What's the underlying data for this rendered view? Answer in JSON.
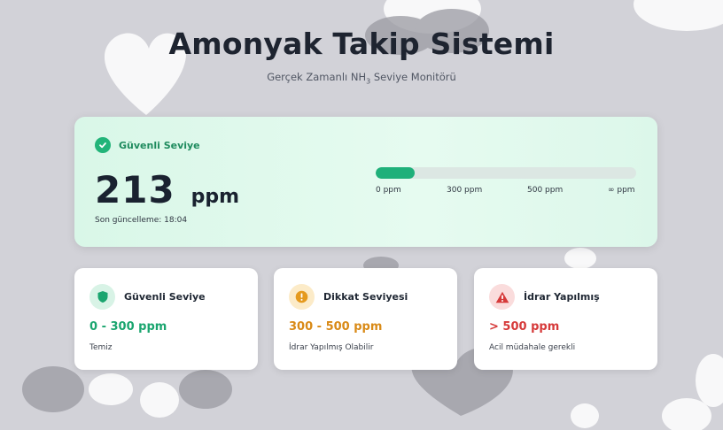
{
  "header": {
    "title": "Amonyak Takip Sistemi",
    "subtitle_prefix": "Gerçek Zamanlı NH",
    "subtitle_subscript": "3",
    "subtitle_suffix": " Seviye Monitörü"
  },
  "current": {
    "status": "Güvenli Seviye",
    "value": "213",
    "unit": "ppm",
    "updated": "Son güncelleme: 18:04",
    "bar_fraction": 0.15,
    "scale_labels": [
      "0 ppm",
      "300 ppm",
      "500 ppm",
      "∞ ppm"
    ]
  },
  "levels": [
    {
      "title": "Güvenli Seviye",
      "range": "0 - 300 ppm",
      "desc": "Temiz",
      "icon": "shield-icon",
      "color": "#1aa56f",
      "bg": "#d8f3e6"
    },
    {
      "title": "Dikkat Seviyesi",
      "range": "300 - 500 ppm",
      "desc": "İdrar Yapılmış Olabilir",
      "icon": "warning-circle-icon",
      "color": "#d98a17",
      "bg": "#fcebc8"
    },
    {
      "title": "İdrar Yapılmış",
      "range": "> 500 ppm",
      "desc": "Acil müdahale gerekli",
      "icon": "alert-triangle-icon",
      "color": "#d63a3a",
      "bg": "#fadcdc"
    }
  ],
  "colors": {
    "safe": "#1fb07a",
    "warning": "#d98a17",
    "danger": "#d63a3a"
  }
}
